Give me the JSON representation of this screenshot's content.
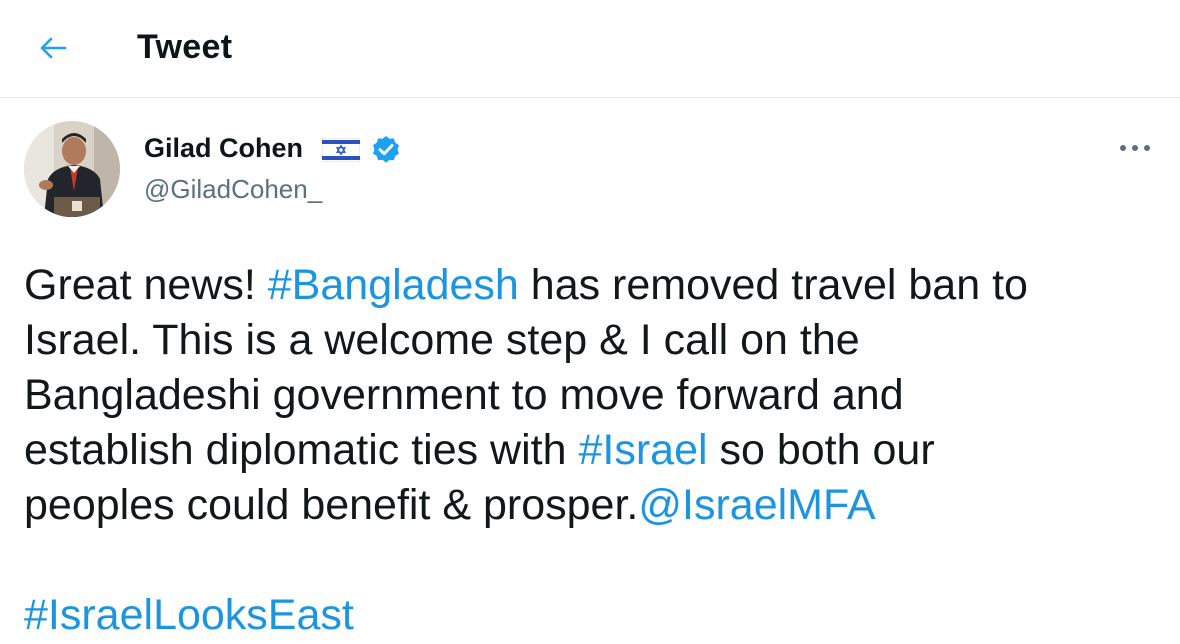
{
  "header": {
    "title": "Tweet"
  },
  "author": {
    "name": "Gilad Cohen",
    "handle": "@GiladCohen_",
    "flag_icon": "israel-flag-icon",
    "verified_icon": "verified-badge-icon"
  },
  "tweet": {
    "segments": [
      {
        "text": "Great news! ",
        "type": "text"
      },
      {
        "text": "#Bangladesh",
        "type": "hashtag"
      },
      {
        "text": " has removed travel ban to\nIsrael. This is a welcome step & I call on the\nBangladeshi government to move forward and\nestablish diplomatic ties with ",
        "type": "text"
      },
      {
        "text": "#Israel",
        "type": "hashtag"
      },
      {
        "text": " so both our\npeoples could benefit & prosper.",
        "type": "text"
      },
      {
        "text": "@IsraelMFA",
        "type": "mention"
      },
      {
        "text": "\n\n",
        "type": "text"
      },
      {
        "text": "#IsraelLooksEast",
        "type": "hashtag"
      }
    ]
  },
  "colors": {
    "accent": "#1da1f2",
    "link": "#1b95e0",
    "secondary_text": "#5b7083",
    "divider": "#e6ecf0"
  }
}
